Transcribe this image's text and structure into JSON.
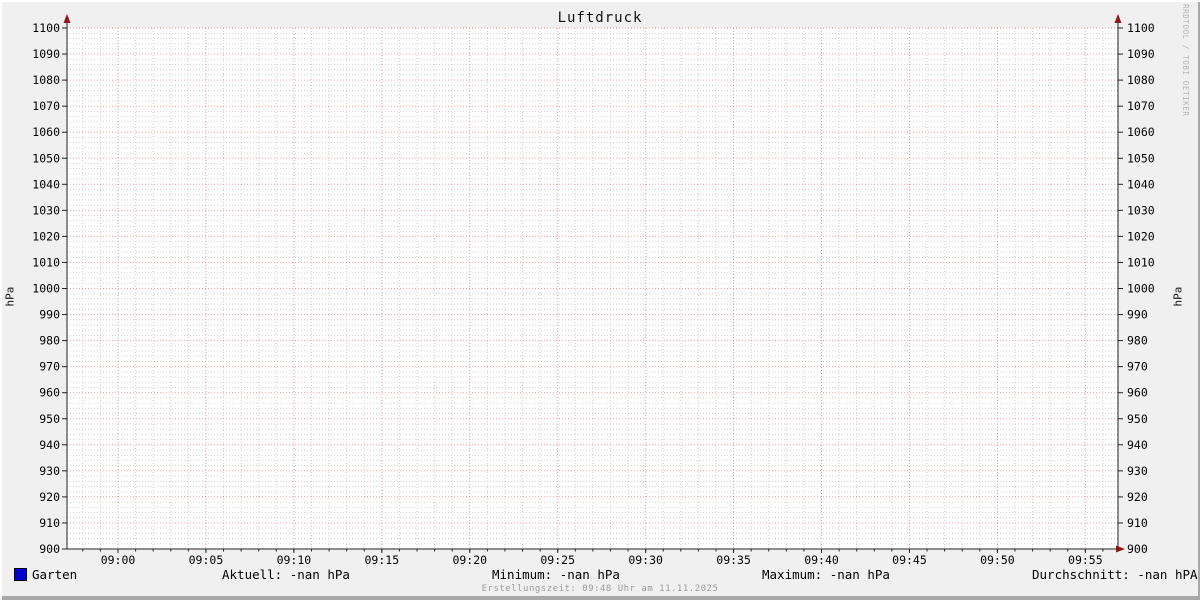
{
  "page": {
    "background": "#f0f0f0"
  },
  "chart_data": {
    "type": "line",
    "title": "Luftdruck",
    "ylabel_left": "hPa",
    "ylabel_right": "hPa",
    "ylim": [
      900,
      1100
    ],
    "y_major_step": 10,
    "y_minor_step": 2,
    "y_major_tick_labels": [
      "900",
      "910",
      "920",
      "930",
      "940",
      "950",
      "960",
      "970",
      "980",
      "990",
      "1000",
      "1010",
      "1020",
      "1030",
      "1040",
      "1050",
      "1060",
      "1070",
      "1080",
      "1090",
      "1100"
    ],
    "x_major_labels": [
      "09:00",
      "09:05",
      "09:10",
      "09:15",
      "09:20",
      "09:25",
      "09:30",
      "09:35",
      "09:40",
      "09:45",
      "09:50",
      "09:55"
    ],
    "x_minor_per_major": 5,
    "x_lead_minor_count": 2,
    "x_trail_minor_count": 1,
    "grid": {
      "major_color": "rgba(235,40,40,0.45)",
      "minor_color": "#d2d2d2",
      "axis_color": "#222222",
      "arrow_color": "#8b1a1a",
      "canvas_color": "#ffffff"
    },
    "legend_position": "bottom",
    "series": [
      {
        "name": "Garten",
        "color": "#0000cc",
        "values": []
      }
    ]
  },
  "legend": {
    "label": "Garten",
    "swatch_color": "#0000cc"
  },
  "stats": {
    "aktuell": "Aktuell: -nan hPa",
    "minimum": "Minimum: -nan hPa",
    "maximum": "Maximum: -nan hPa",
    "durchschnitt": "Durchschnitt: -nan hPA"
  },
  "footer": {
    "text": "Erstellungszeit: 09:48 Uhr am 11.11.2025"
  },
  "watermark": "RRDTOOL / TOBI OETIKER"
}
